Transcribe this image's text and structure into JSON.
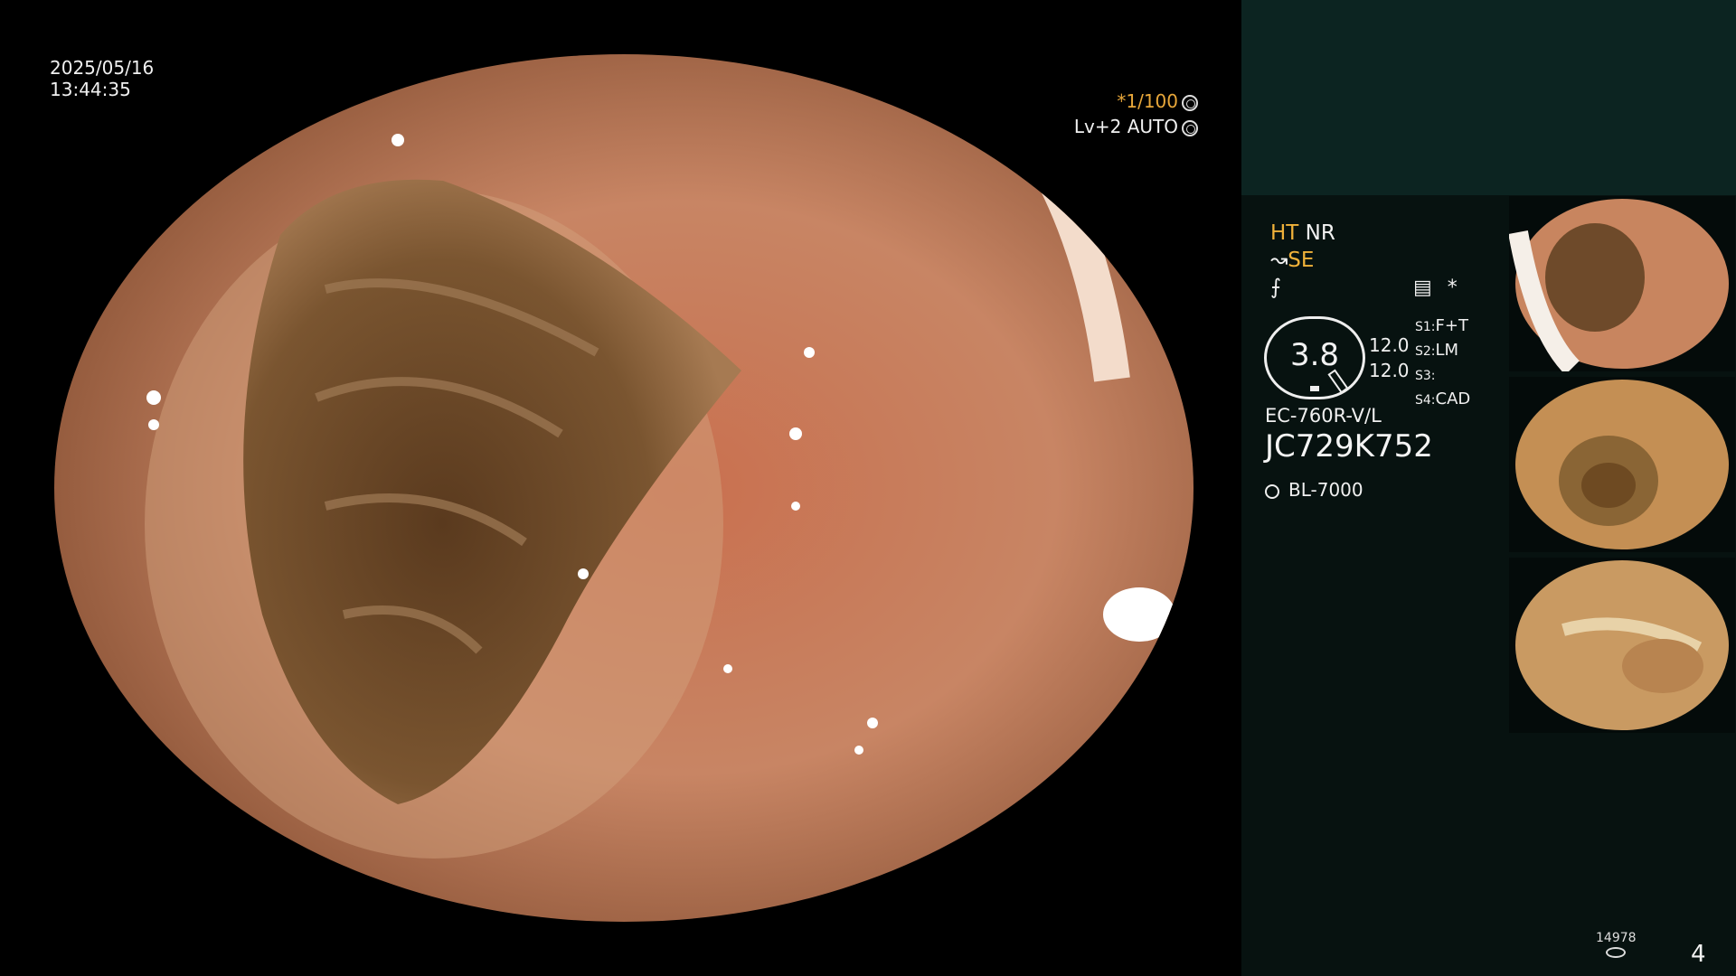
{
  "overlay": {
    "date": "2025/05/16",
    "time": "13:44:35",
    "shutter": "*1/100",
    "level": "Lv+2 AUTO"
  },
  "sidebar": {
    "ht": "HT",
    "nr": "NR",
    "se": "SE",
    "asterisk": "*",
    "gauge_value": "3.8",
    "val1": "12.0",
    "val2": "12.0",
    "modes": [
      {
        "key": "S1:",
        "value": "F+T"
      },
      {
        "key": "S2:",
        "value": "LM"
      },
      {
        "key": "S3:",
        "value": ""
      },
      {
        "key": "S4:",
        "value": "CAD"
      }
    ],
    "model": "EC-760R-V/L",
    "serial": "JC729K752",
    "lamp": "BL-7000",
    "counter": "14978",
    "page": "4"
  },
  "colors": {
    "accent": "#f0b23a",
    "panel_bg": "#071210",
    "panel_top": "#0c2421",
    "mucosa": "#c98866"
  },
  "icons": [
    "shutter-wheel-icon",
    "auto-iris-icon",
    "scope-curve-icon",
    "structure-icon",
    "chart-icon",
    "lamp-icon",
    "disk-icon"
  ]
}
